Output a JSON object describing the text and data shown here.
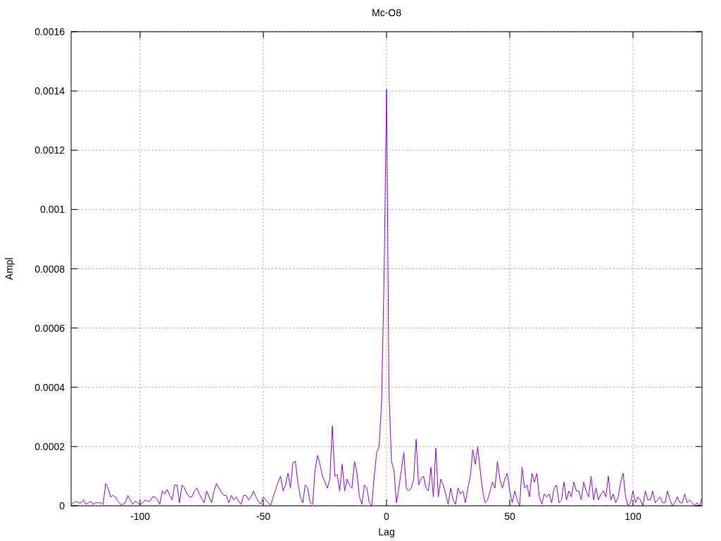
{
  "chart_data": {
    "type": "line",
    "grid": true,
    "title": "Mc-O8",
    "xlabel": "Lag",
    "ylabel": "Ampl",
    "xlim": [
      -128,
      128
    ],
    "ylim": [
      0,
      0.0016
    ],
    "xticks": [
      -100,
      -50,
      0,
      50,
      100
    ],
    "yticks": [
      {
        "value": 0,
        "label": "0"
      },
      {
        "value": 0.0002,
        "label": "0.0002"
      },
      {
        "value": 0.0004,
        "label": "0.0004"
      },
      {
        "value": 0.0006,
        "label": "0.0006"
      },
      {
        "value": 0.0008,
        "label": "0.0008"
      },
      {
        "value": 0.001,
        "label": "0.001"
      },
      {
        "value": 0.0012,
        "label": "0.0012"
      },
      {
        "value": 0.0014,
        "label": "0.0014"
      },
      {
        "value": 0.0016,
        "label": "0.0016"
      }
    ],
    "x": [
      -128,
      -127,
      -126,
      -125,
      -124,
      -123,
      -122,
      -121,
      -120,
      -119,
      -118,
      -117,
      -116,
      -115,
      -114,
      -113,
      -112,
      -111,
      -110,
      -109,
      -108,
      -107,
      -106,
      -105,
      -104,
      -103,
      -102,
      -101,
      -100,
      -99,
      -98,
      -97,
      -96,
      -95,
      -94,
      -93,
      -92,
      -91,
      -90,
      -89,
      -88,
      -87,
      -86,
      -85,
      -84,
      -83,
      -82,
      -81,
      -80,
      -79,
      -78,
      -77,
      -76,
      -75,
      -74,
      -73,
      -72,
      -71,
      -70,
      -69,
      -68,
      -67,
      -66,
      -65,
      -64,
      -63,
      -62,
      -61,
      -60,
      -59,
      -58,
      -57,
      -56,
      -55,
      -54,
      -53,
      -52,
      -51,
      -50,
      -49,
      -48,
      -47,
      -46,
      -45,
      -44,
      -43,
      -42,
      -41,
      -40,
      -39,
      -38,
      -37,
      -36,
      -35,
      -34,
      -33,
      -32,
      -31,
      -30,
      -29,
      -28,
      -27,
      -26,
      -25,
      -24,
      -23,
      -22,
      -21,
      -20,
      -19,
      -18,
      -17,
      -16,
      -15,
      -14,
      -13,
      -12,
      -11,
      -10,
      -9,
      -8,
      -7,
      -6,
      -5,
      -4,
      -3,
      -2,
      -1,
      0,
      1,
      2,
      3,
      4,
      5,
      6,
      7,
      8,
      9,
      10,
      11,
      12,
      13,
      14,
      15,
      16,
      17,
      18,
      19,
      20,
      21,
      22,
      23,
      24,
      25,
      26,
      27,
      28,
      29,
      30,
      31,
      32,
      33,
      34,
      35,
      36,
      37,
      38,
      39,
      40,
      41,
      42,
      43,
      44,
      45,
      46,
      47,
      48,
      49,
      50,
      51,
      52,
      53,
      54,
      55,
      56,
      57,
      58,
      59,
      60,
      61,
      62,
      63,
      64,
      65,
      66,
      67,
      68,
      69,
      70,
      71,
      72,
      73,
      74,
      75,
      76,
      77,
      78,
      79,
      80,
      81,
      82,
      83,
      84,
      85,
      86,
      87,
      88,
      89,
      90,
      91,
      92,
      93,
      94,
      95,
      96,
      97,
      98,
      99,
      100,
      101,
      102,
      103,
      104,
      105,
      106,
      107,
      108,
      109,
      110,
      111,
      112,
      113,
      114,
      115,
      116,
      117,
      118,
      119,
      120,
      121,
      122,
      123,
      124,
      125,
      126,
      127,
      128
    ],
    "series": [
      {
        "color": "#9400d3",
        "values": [
          5e-06,
          1e-05,
          1.5e-05,
          1e-05,
          1e-05,
          2e-05,
          5e-06,
          1e-05,
          1.5e-05,
          5e-06,
          1e-05,
          1e-05,
          1e-05,
          5e-06,
          7.5e-05,
          6e-05,
          3e-05,
          3.5e-05,
          3e-05,
          1.5e-05,
          5e-06,
          5e-06,
          1e-05,
          3.5e-05,
          2e-05,
          5e-06,
          1.5e-05,
          1e-05,
          5e-06,
          1e-05,
          2e-05,
          1.5e-05,
          1.5e-05,
          3e-05,
          3e-05,
          2e-05,
          5e-06,
          5e-05,
          4e-05,
          5.5e-05,
          3.5e-05,
          2e-05,
          7e-05,
          7e-05,
          1e-05,
          7e-05,
          6e-05,
          4e-05,
          3e-05,
          3e-05,
          5e-05,
          6e-05,
          4e-05,
          2.5e-05,
          1e-05,
          5e-05,
          3e-05,
          1e-05,
          5e-05,
          7.5e-05,
          6e-05,
          4.5e-05,
          3.5e-05,
          3.5e-05,
          1e-05,
          3.5e-05,
          2e-05,
          3e-05,
          1.5e-05,
          5e-06,
          3.5e-05,
          3.5e-05,
          2e-05,
          3e-05,
          5e-05,
          3e-05,
          1.5e-05,
          5e-06,
          3e-05,
          2e-05,
          1e-05,
          2e-06,
          3e-05,
          5.5e-05,
          8e-05,
          0.0001,
          5e-05,
          7e-05,
          0.00011,
          6e-05,
          0.000145,
          0.00015,
          8e-05,
          3e-05,
          1e-05,
          7e-05,
          6e-05,
          1e-05,
          5e-06,
          0.00012,
          0.00017,
          0.00014,
          0.0001,
          8e-05,
          6e-05,
          9e-05,
          0.00027,
          0.0001,
          0.000105,
          5e-05,
          0.00014,
          5e-05,
          9e-05,
          7e-05,
          6e-05,
          0.00015,
          0.00011,
          3e-05,
          5e-06,
          7e-05,
          6e-05,
          1e-05,
          0.0,
          0.0001,
          0.00018,
          0.0002,
          0.00035,
          0.00077,
          0.001405,
          0.00038,
          0.00015,
          0.00012,
          1e-05,
          6e-05,
          0.00012,
          0.00018,
          6e-05,
          5e-05,
          6e-05,
          9e-05,
          0.000225,
          7e-05,
          9e-05,
          0.0001,
          6e-05,
          5e-05,
          0.00013,
          3e-05,
          0.000195,
          3e-05,
          9e-05,
          7e-05,
          4e-05,
          5e-06,
          6e-05,
          2e-05,
          5e-06,
          6e-05,
          4e-05,
          5e-05,
          1e-05,
          6e-05,
          0.0001,
          0.00019,
          0.00014,
          0.0002,
          0.00012,
          5e-05,
          1e-05,
          2e-05,
          5e-05,
          8e-05,
          6e-05,
          0.00015,
          9e-05,
          6e-05,
          9e-05,
          0.00011,
          5e-05,
          1e-05,
          5e-05,
          2e-05,
          0.0,
          0.00013,
          6e-05,
          7e-05,
          3e-05,
          0.00011,
          8e-05,
          0.00011,
          3e-05,
          5e-06,
          4e-05,
          3e-05,
          4e-05,
          1e-05,
          6e-05,
          7e-05,
          1e-05,
          2e-05,
          8e-05,
          2e-05,
          5e-05,
          3e-05,
          8e-05,
          5e-05,
          5e-05,
          2e-05,
          8e-05,
          5e-05,
          3e-05,
          0.0001,
          2e-05,
          6e-05,
          2e-05,
          4e-05,
          5e-05,
          3e-05,
          0.0001,
          2e-05,
          4e-05,
          1e-05,
          3e-05,
          8e-05,
          0.00011,
          3e-05,
          0.0,
          1e-05,
          5e-05,
          1e-05,
          3e-05,
          2e-05,
          0.0,
          5e-05,
          2e-05,
          2e-05,
          5e-05,
          1e-05,
          2e-05,
          3e-05,
          1e-05,
          1e-05,
          5e-05,
          2e-05,
          0.0,
          1e-05,
          3e-05,
          1e-05,
          1e-05,
          4e-05,
          1e-05,
          2e-05,
          1e-05,
          0.0,
          1e-05,
          0.0,
          2.5e-05
        ]
      }
    ]
  }
}
